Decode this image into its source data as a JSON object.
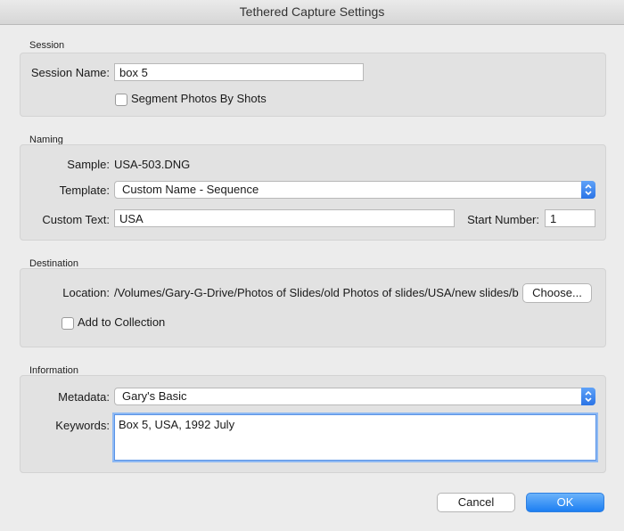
{
  "window": {
    "title": "Tethered Capture Settings"
  },
  "session": {
    "section_label": "Session",
    "name_label": "Session Name:",
    "name_value": "box 5",
    "segment_label": "Segment Photos By Shots",
    "segment_checked": false
  },
  "naming": {
    "section_label": "Naming",
    "sample_label": "Sample:",
    "sample_value": "USA-503.DNG",
    "template_label": "Template:",
    "template_value": "Custom Name - Sequence",
    "custom_text_label": "Custom Text:",
    "custom_text_value": "USA",
    "start_number_label": "Start Number:",
    "start_number_value": "1"
  },
  "destination": {
    "section_label": "Destination",
    "location_label": "Location:",
    "location_value": "/Volumes/Gary-G-Drive/Photos of Slides/old Photos of slides/USA/new slides/b",
    "choose_label": "Choose...",
    "add_collection_label": "Add to Collection",
    "add_collection_checked": false
  },
  "information": {
    "section_label": "Information",
    "metadata_label": "Metadata:",
    "metadata_value": "Gary's Basic",
    "keywords_label": "Keywords:",
    "keywords_value": "Box 5, USA, 1992 July"
  },
  "footer": {
    "cancel_label": "Cancel",
    "ok_label": "OK"
  },
  "colors": {
    "accent": "#2b74e6",
    "panel": "#e2e2e2",
    "window": "#ececec"
  }
}
